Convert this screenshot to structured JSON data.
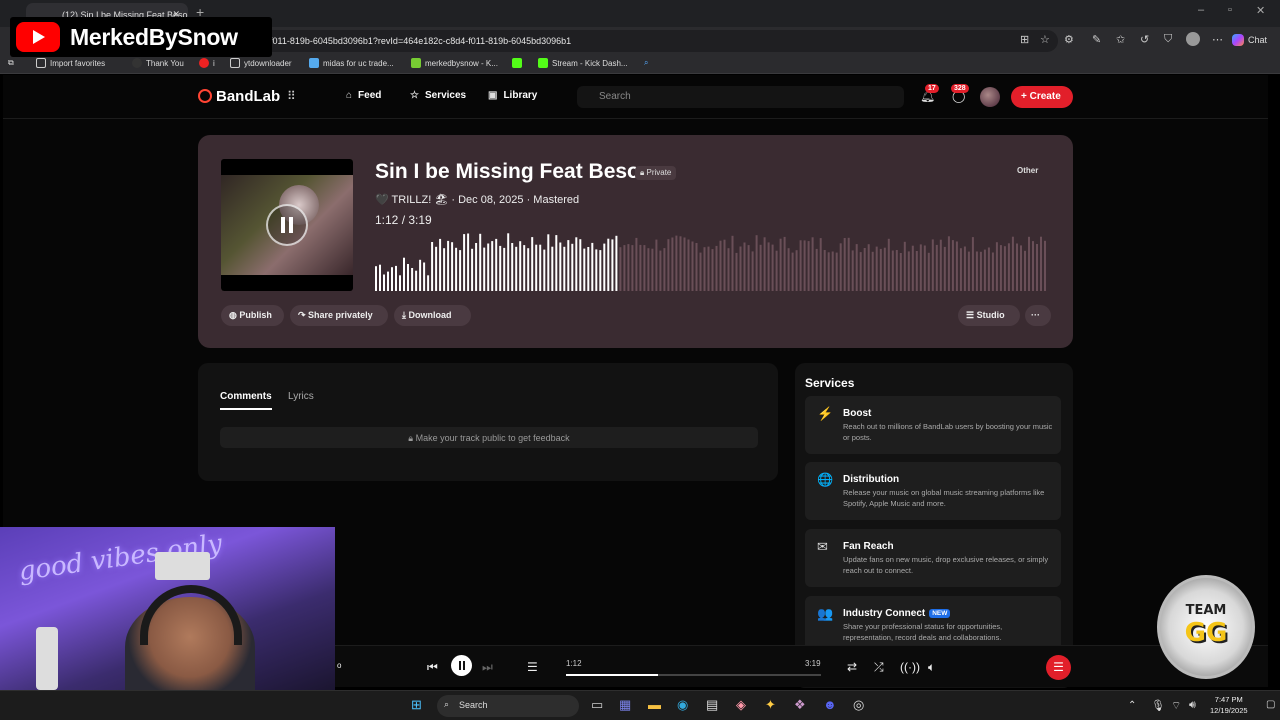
{
  "browser": {
    "tab_title": "(12) Sin I be Missing Feat Beso",
    "url": "f011-819b-6045bd3096b1?revId=464e182c-c8d4-f011-819b-6045bd3096b1",
    "chat_label": "Chat",
    "bookmarks": [
      "Import favorites",
      "Thank You",
      "i",
      "ytdownloader",
      "midas for uc trade...",
      "merkedbysnow - K...",
      "Stream - Kick Dash..."
    ]
  },
  "overlay": {
    "channel_name": "MerkedBySnow"
  },
  "nav": {
    "logo": "BandLab",
    "feed": "Feed",
    "services": "Services",
    "library": "Library",
    "search_placeholder": "Search",
    "notifications_count": "17",
    "messages_count": "328",
    "create": "Create"
  },
  "track": {
    "title": "Sin I be Missing Feat Beso",
    "visibility": "Private",
    "genre": "Other",
    "meta": "🖤 TRILLZ! 🏖 · Dec 08, 2025 · Mastered",
    "time": "1:12 /  3:19",
    "progress_fraction": 0.361,
    "buttons": {
      "publish": "Publish",
      "share": "Share privately",
      "download": "Download",
      "studio": "Studio",
      "more": "···"
    }
  },
  "comments": {
    "tab_comments": "Comments",
    "tab_lyrics": "Lyrics",
    "feedback": "Make your track public to get feedback"
  },
  "services": {
    "title": "Services",
    "items": [
      {
        "name": "Boost",
        "desc": "Reach out to millions of BandLab users by boosting your music or posts.",
        "icon": "⚡"
      },
      {
        "name": "Distribution",
        "desc": "Release your music on global music streaming platforms like Spotify, Apple Music and more.",
        "icon": "🌐"
      },
      {
        "name": "Fan Reach",
        "desc": "Update fans on new music, drop exclusive releases, or simply reach out to connect.",
        "icon": "✉"
      },
      {
        "name": "Industry Connect",
        "desc": "Share your professional status for opportunities, representation, record deals and collaborations.",
        "icon": "👥",
        "badge": "NEW"
      }
    ]
  },
  "player": {
    "current": "1:12",
    "duration": "3:19",
    "progress_fraction": 0.361
  },
  "taskbar": {
    "search": "Search",
    "time": "7:47 PM",
    "date": "12/19/2025"
  },
  "webcam": {
    "neon_sign": "good vibes only"
  },
  "badge": {
    "line1": "TEAM",
    "line2": "GG"
  },
  "colors": {
    "accent": "#e21f2a",
    "card": "#3a2b31",
    "wave_played": "#ffffff",
    "wave_unplayed": "#6a4f58"
  }
}
